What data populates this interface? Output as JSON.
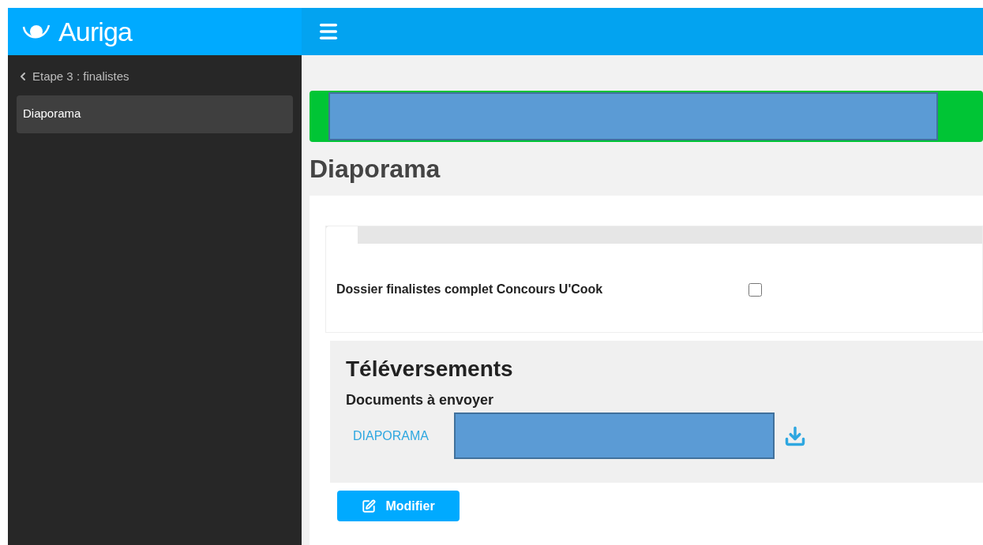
{
  "brand": {
    "name": "Auriga"
  },
  "sidebar": {
    "back_link": "Etape 3 : finalistes",
    "items": [
      {
        "label": "Diaporama",
        "selected": true
      }
    ]
  },
  "page": {
    "title": "Diaporama"
  },
  "form": {
    "fields": [
      {
        "label": "Dossier finalistes complet Concours U'Cook",
        "checked": false
      }
    ]
  },
  "uploads": {
    "title": "Téléversements",
    "subtitle": "Documents à envoyer",
    "documents": [
      {
        "name": "DIAPORAMA"
      }
    ]
  },
  "actions": {
    "edit_button": "Modifier"
  }
}
